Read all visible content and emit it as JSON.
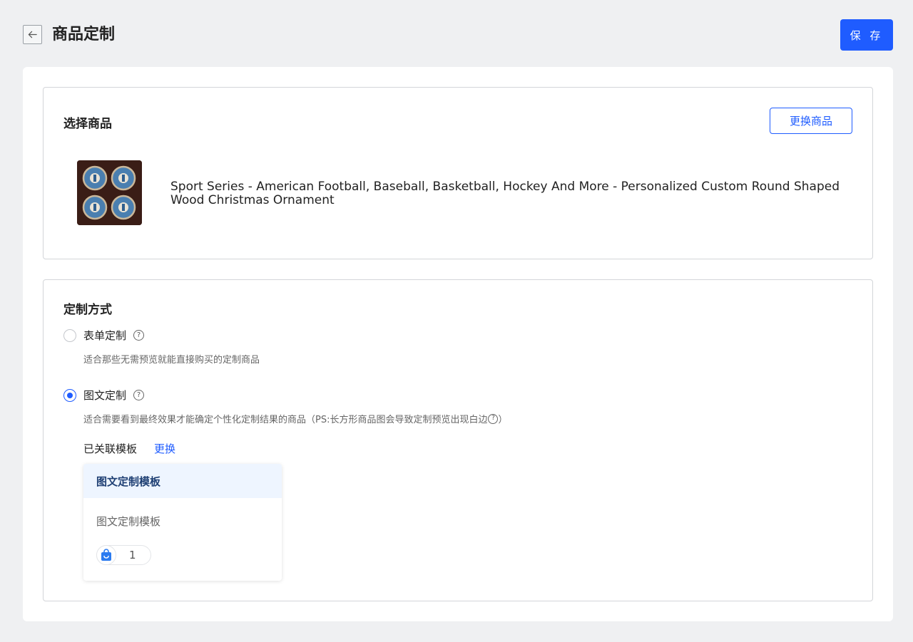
{
  "header": {
    "title": "商品定制",
    "save_label": "保 存"
  },
  "product_section": {
    "title": "选择商品",
    "change_button": "更换商品",
    "product_name": "Sport Series - American Football, Baseball, Basketball, Hockey And More - Personalized Custom Round Shaped Wood Christmas Ornament"
  },
  "custom_section": {
    "title": "定制方式",
    "options": [
      {
        "label": "表单定制",
        "description": "适合那些无需预览就能直接购买的定制商品",
        "selected": false
      },
      {
        "label": "图文定制",
        "description": "适合需要看到最终效果才能确定个性化定制结果的商品（PS:长方形商品图会导致定制预览出现白边",
        "description_suffix": "）",
        "selected": true
      }
    ],
    "linked_template_label": "已关联模板",
    "linked_template_change": "更换",
    "template": {
      "header": "图文定制模板",
      "name": "图文定制模板",
      "count": "1"
    }
  },
  "colors": {
    "primary": "#1f5cff",
    "background": "#eff0f2",
    "template_header_bg": "#eef5ff"
  },
  "icons": {
    "back": "arrow-left-icon",
    "help": "question-circle-icon",
    "bag": "shopping-bag-icon"
  }
}
